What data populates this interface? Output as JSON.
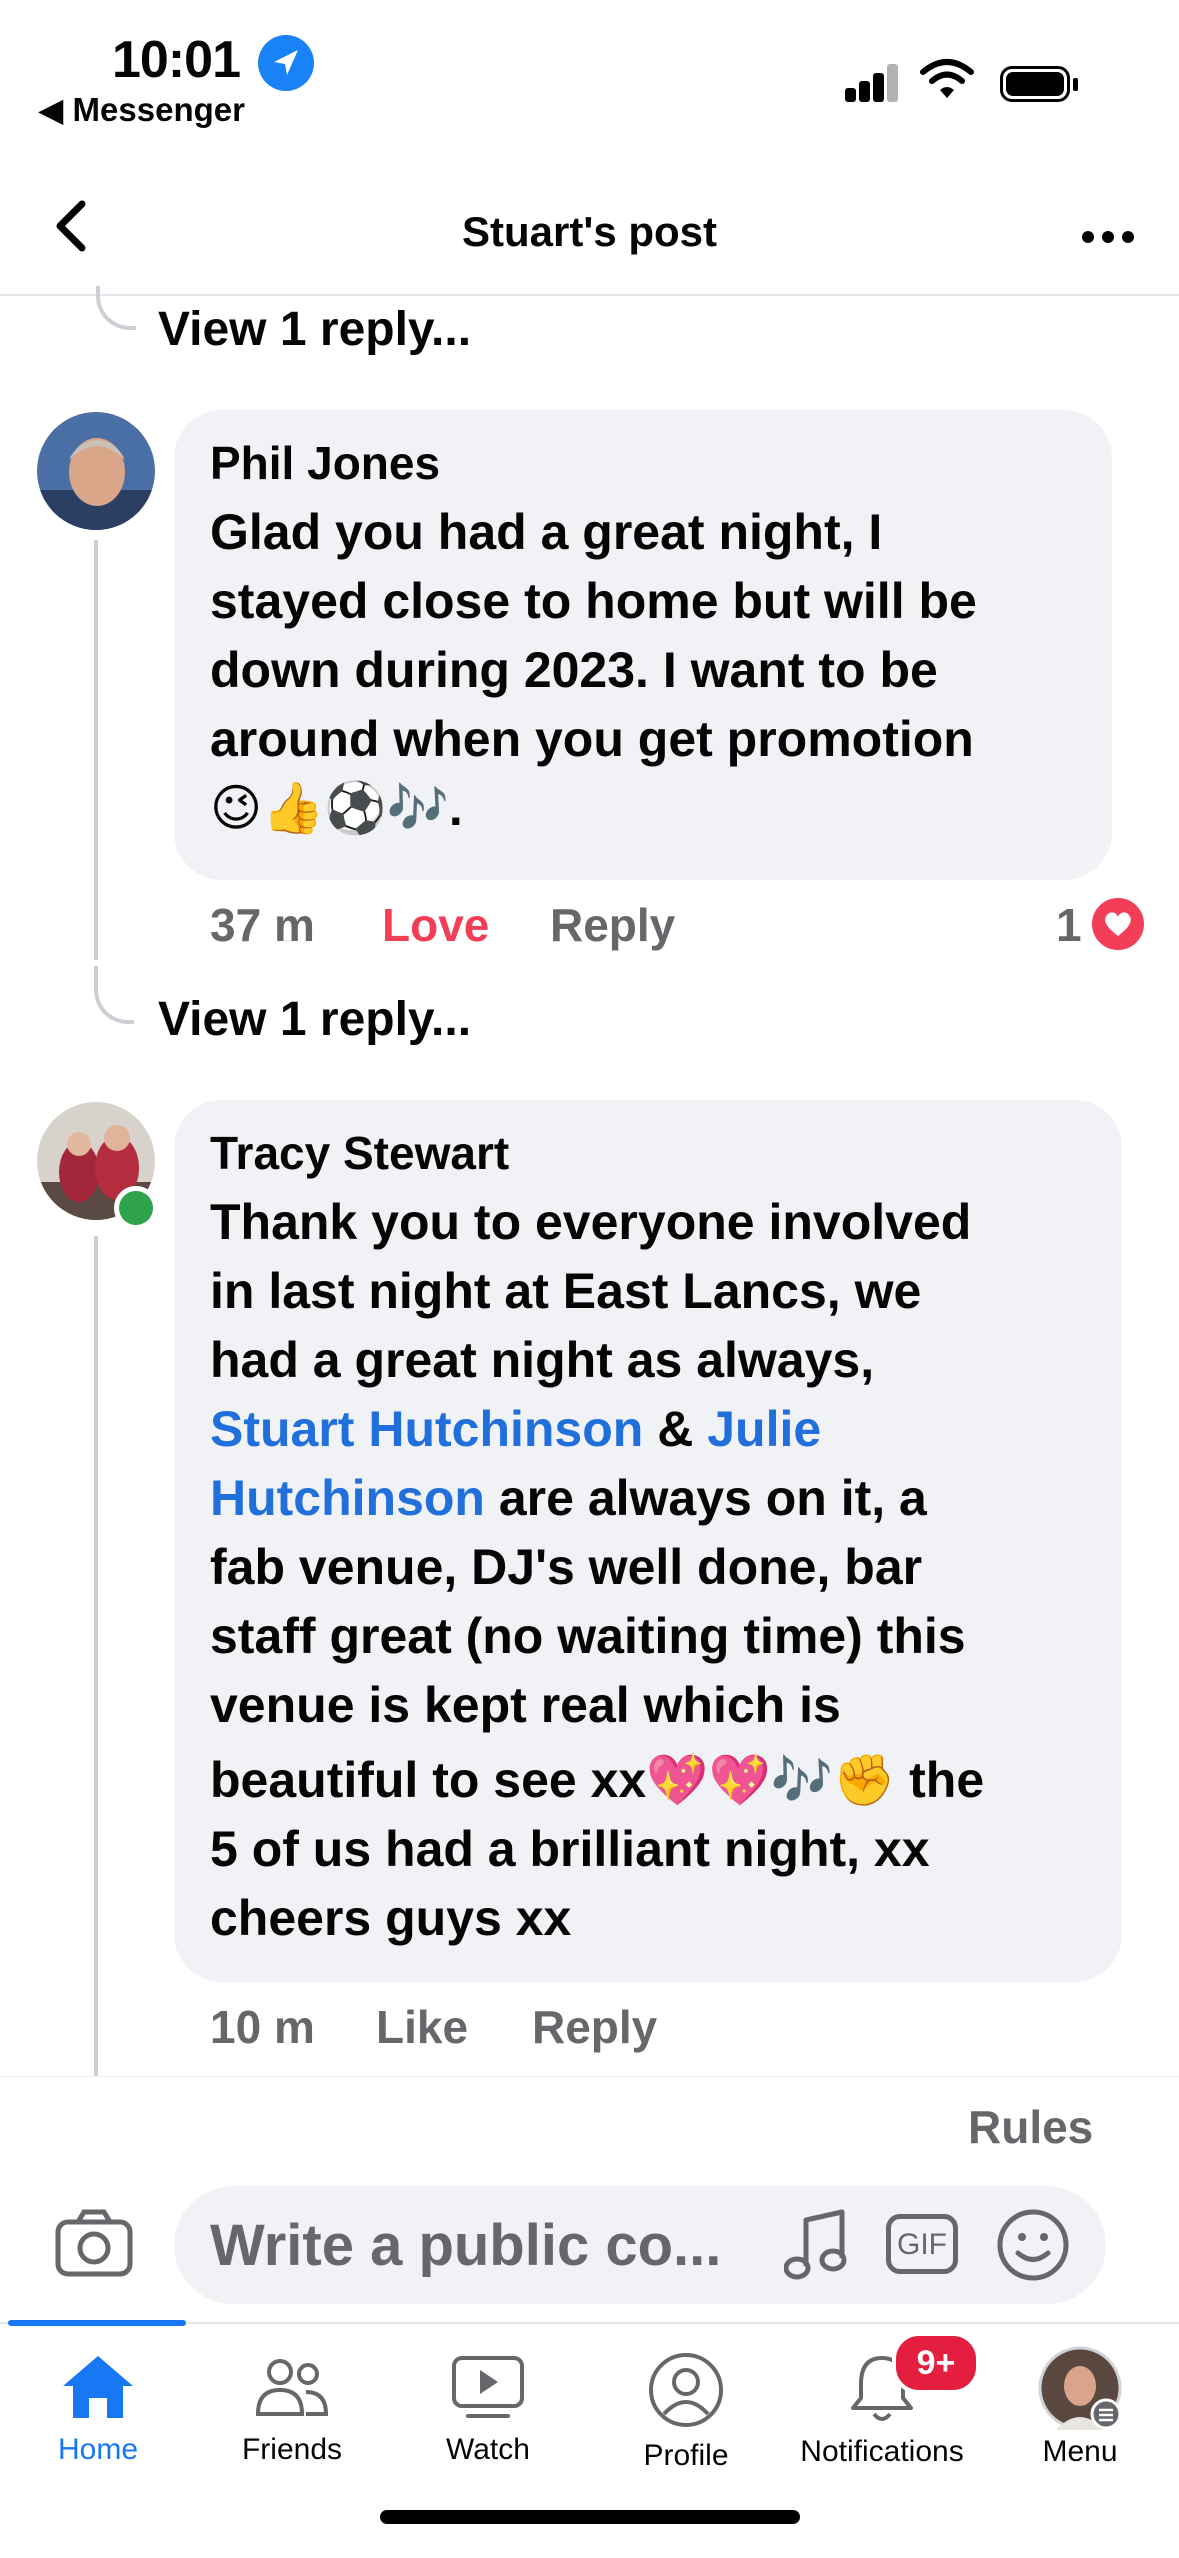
{
  "status_bar": {
    "time": "10:01",
    "back_app": "◀ Messenger",
    "icons": [
      "location-arrow-icon",
      "cellular-signal-icon",
      "wifi-icon",
      "battery-icon"
    ]
  },
  "nav": {
    "title": "Stuart's post",
    "back_icon": "chevron-left-icon",
    "more_icon": "more-horizontal-icon"
  },
  "thread": {
    "view_reply_label": "View 1 reply...",
    "comments": [
      {
        "author": "Phil Jones",
        "text_lines": [
          "Glad you had a great night, I",
          "stayed close to home but will be",
          "down during 2023. I want to be",
          "around when you get promotion",
          "😉👍⚽🎶."
        ],
        "time": "37 m",
        "reaction_label": "Love",
        "reply_label": "Reply",
        "reaction_count": "1",
        "reaction_icon": "love-heart-icon"
      },
      {
        "author": "Tracy Stewart",
        "online": true,
        "text_parts": {
          "line1": "Thank you to everyone involved",
          "line2": "in last night at East Lancs, we",
          "line3": "had a great night as always,",
          "mention1": "Stuart Hutchinson",
          "amp": " & ",
          "mention2a": "Julie",
          "mention2b": "Hutchinson",
          "line5_rest": " are always on it, a",
          "line6": "fab venue, DJ's well done, bar",
          "line7": "staff great (no waiting time) this",
          "line8": "venue is kept real which is",
          "line9": "beautiful to see xx💖💖🎶✊ the",
          "line10": "5 of us had a brilliant night, xx",
          "line11": "cheers guys xx"
        },
        "time": "10 m",
        "like_label": "Like",
        "reply_label": "Reply"
      }
    ]
  },
  "composer": {
    "rules_label": "Rules",
    "placeholder": "Write a public co...",
    "camera_icon": "camera-icon",
    "music_icon": "music-note-icon",
    "gif_label": "GIF",
    "emoji_icon": "emoji-smile-icon"
  },
  "tab_bar": {
    "tabs": [
      {
        "label": "Home",
        "icon": "home-icon",
        "active": true
      },
      {
        "label": "Friends",
        "icon": "friends-icon",
        "active": false
      },
      {
        "label": "Watch",
        "icon": "watch-video-icon",
        "active": false
      },
      {
        "label": "Profile",
        "icon": "profile-icon",
        "active": false
      },
      {
        "label": "Notifications",
        "icon": "bell-icon",
        "active": false
      },
      {
        "label": "Menu",
        "icon": "menu-avatar-icon",
        "active": false
      }
    ],
    "notifications_badge": "9+"
  },
  "colors": {
    "accent": "#1877f2",
    "mention": "#216fdb",
    "love": "#f33e58",
    "bubble": "#f0f2f5",
    "meta": "#65676b",
    "online": "#31a24c",
    "badge": "#e41e3f"
  }
}
